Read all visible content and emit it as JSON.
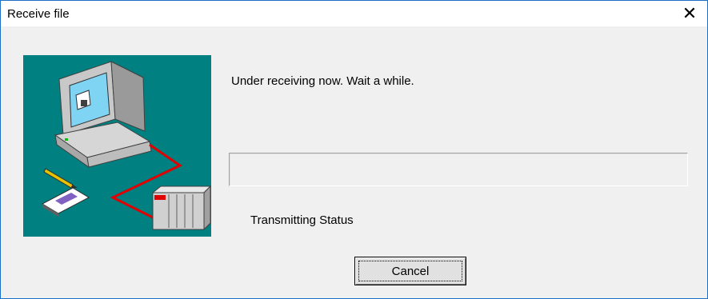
{
  "window": {
    "title": "Receive file",
    "close_glyph": "✕"
  },
  "illustration": {
    "background": "#008080",
    "icons": [
      "computer-icon",
      "pencil-icon",
      "floppy-disk-icon",
      "cable-icon",
      "plc-unit-icon"
    ]
  },
  "message": "Under receiving now. Wait a while.",
  "progress": {
    "value": 0,
    "fill_color": "#06b025"
  },
  "status_label": "Transmitting Status",
  "buttons": {
    "cancel_label": "Cancel"
  },
  "colors": {
    "window_border": "#1b6fc7",
    "dialog_bg": "#f0f0f0"
  }
}
